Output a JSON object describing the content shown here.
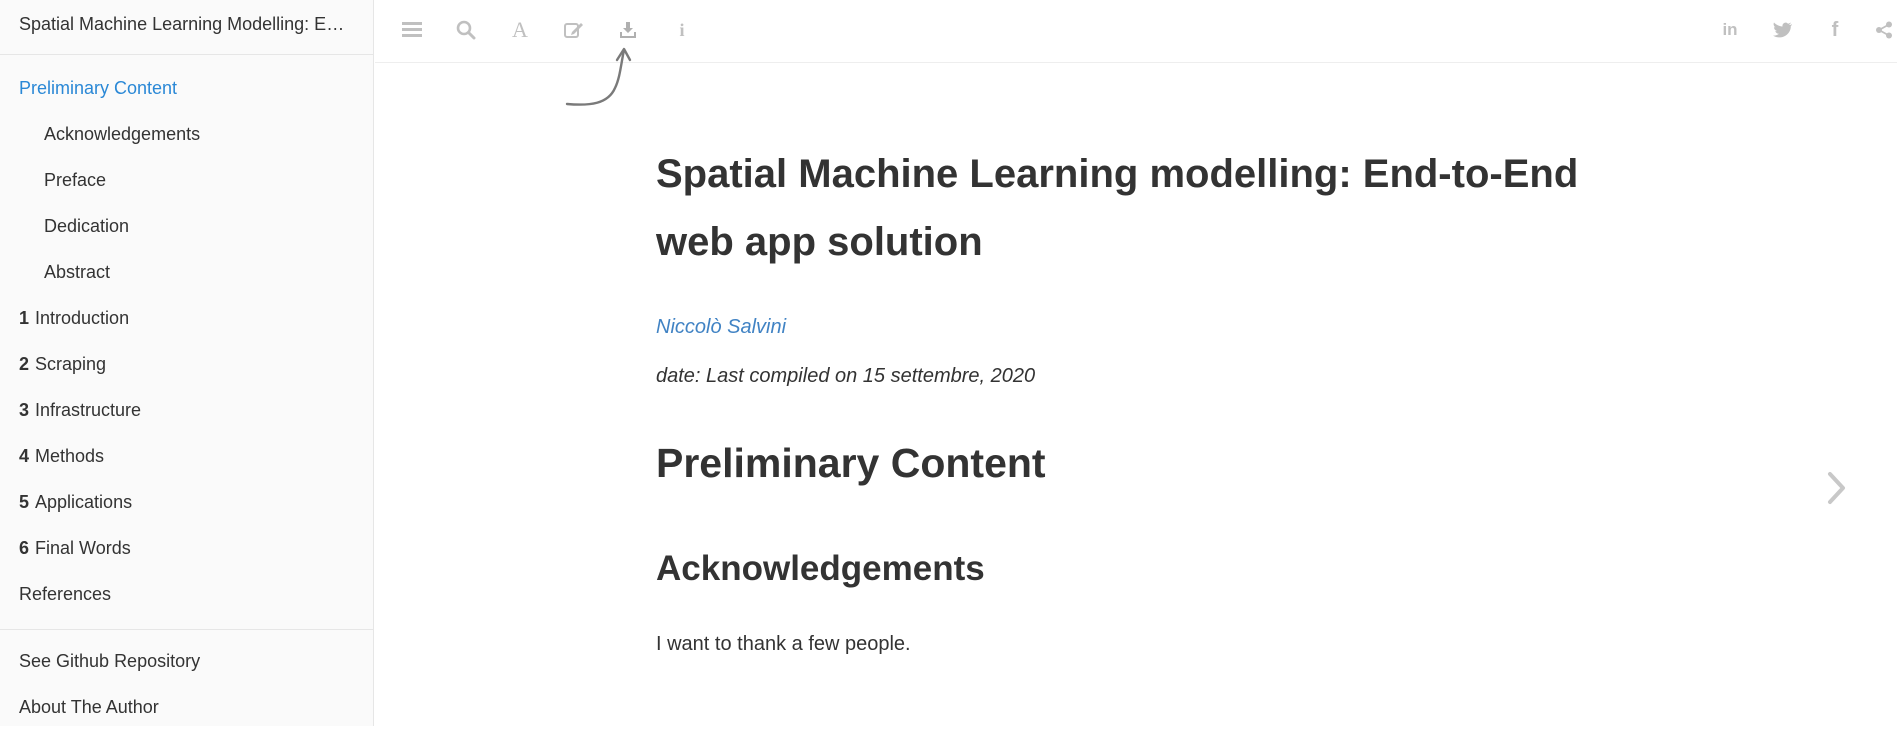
{
  "sidebar": {
    "book_title": "Spatial Machine Learning Modelling: End-to-End web app solution",
    "toc": [
      {
        "num": "",
        "label": "Preliminary Content",
        "level": 0,
        "active": true
      },
      {
        "num": "",
        "label": "Acknowledgements",
        "level": 1,
        "active": false
      },
      {
        "num": "",
        "label": "Preface",
        "level": 1,
        "active": false
      },
      {
        "num": "",
        "label": "Dedication",
        "level": 1,
        "active": false
      },
      {
        "num": "",
        "label": "Abstract",
        "level": 1,
        "active": false
      },
      {
        "num": "1",
        "label": "Introduction",
        "level": 0,
        "active": false
      },
      {
        "num": "2",
        "label": "Scraping",
        "level": 0,
        "active": false
      },
      {
        "num": "3",
        "label": "Infrastructure",
        "level": 0,
        "active": false
      },
      {
        "num": "4",
        "label": "Methods",
        "level": 0,
        "active": false
      },
      {
        "num": "5",
        "label": "Applications",
        "level": 0,
        "active": false
      },
      {
        "num": "6",
        "label": "Final Words",
        "level": 0,
        "active": false
      },
      {
        "num": "",
        "label": "References",
        "level": 0,
        "active": false
      }
    ],
    "links": [
      "See Github Repository",
      "About The Author"
    ]
  },
  "toolbar": {
    "left_icons": [
      "toggle-sidebar-icon",
      "search-icon",
      "font-settings-icon",
      "edit-icon",
      "download-icon",
      "info-icon"
    ],
    "right_icons": [
      "linkedin-icon",
      "twitter-icon",
      "facebook-icon",
      "share-icon"
    ]
  },
  "content": {
    "title": "Spatial Machine Learning modelling: End-to-End web app solution",
    "author": "Niccolò Salvini",
    "date": "date: Last compiled on 15 settembre, 2020",
    "section_heading": "Preliminary Content",
    "subsection_heading": "Acknowledgements",
    "paragraph": "I want to thank a few people."
  },
  "colors": {
    "accent": "#2a88d6",
    "author_link": "#4183c4",
    "icon_gray": "#c0c0c0",
    "text": "#333333"
  }
}
